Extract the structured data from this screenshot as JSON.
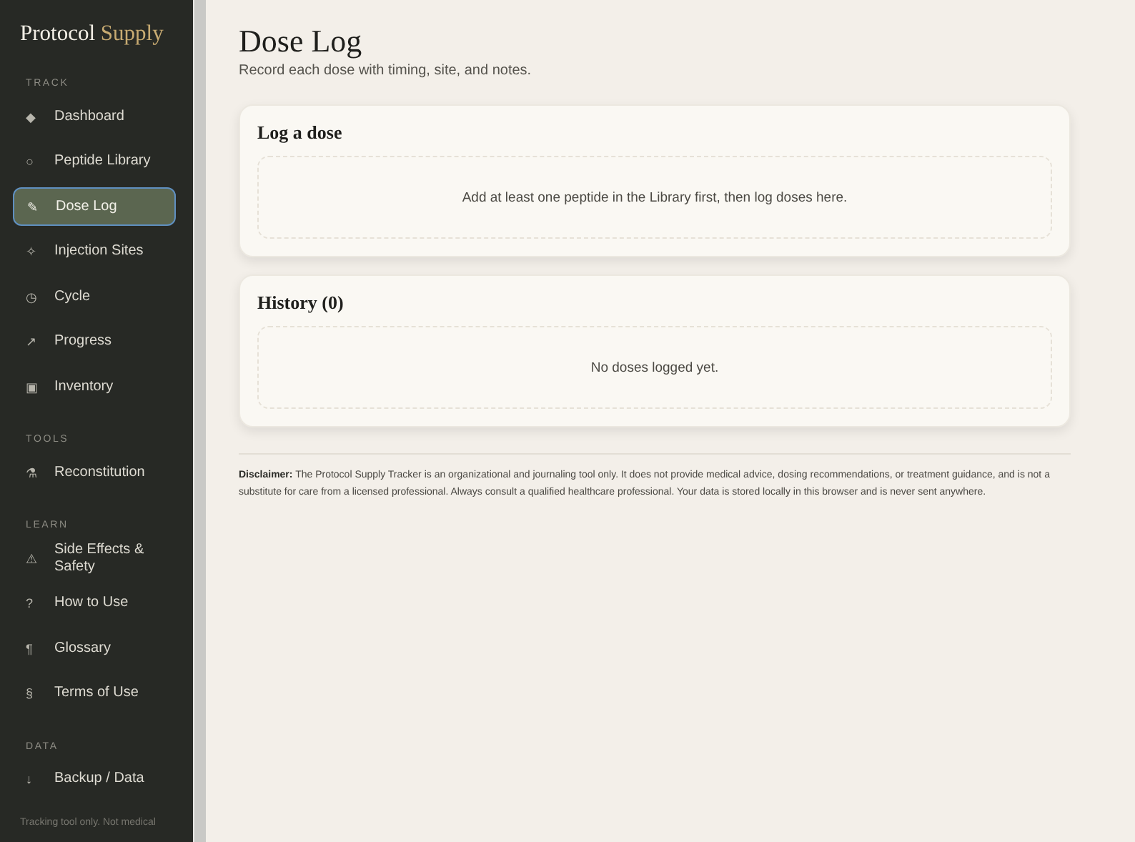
{
  "sidebar": {
    "brand": {
      "first": "Protocol",
      "second": "Supply"
    },
    "sections": [
      {
        "heading": "TRACK",
        "items": [
          {
            "icon": "◆",
            "label": "Dashboard",
            "selected": false
          },
          {
            "icon": "○",
            "label": "Peptide Library",
            "selected": false
          },
          {
            "icon": "✎",
            "label": "Dose Log",
            "selected": true
          },
          {
            "icon": "✧",
            "label": "Injection Sites",
            "selected": false
          },
          {
            "icon": "◷",
            "label": "Cycle",
            "selected": false
          },
          {
            "icon": "↗",
            "label": "Progress",
            "selected": false
          },
          {
            "icon": "▣",
            "label": "Inventory",
            "selected": false
          }
        ]
      },
      {
        "heading": "TOOLS",
        "items": [
          {
            "icon": "⚗",
            "label": "Reconstitution",
            "selected": false
          }
        ]
      },
      {
        "heading": "LEARN",
        "items": [
          {
            "icon": "⚠",
            "label": "Side Effects & Safety",
            "selected": false
          },
          {
            "icon": "?",
            "label": "How to Use",
            "selected": false
          },
          {
            "icon": "¶",
            "label": "Glossary",
            "selected": false
          },
          {
            "icon": "§",
            "label": "Terms of Use",
            "selected": false
          }
        ]
      },
      {
        "heading": "DATA",
        "items": [
          {
            "icon": "↓",
            "label": "Backup / Data",
            "selected": false
          }
        ]
      }
    ],
    "footer": "Tracking tool only. Not medical"
  },
  "page": {
    "title": "Dose Log",
    "subtitle": "Record each dose with timing, site, and notes."
  },
  "cards": [
    {
      "title": "Log a dose",
      "empty": "Add at least one peptide in the Library first, then log doses here."
    },
    {
      "title": "History (0)",
      "empty": "No doses logged yet."
    }
  ],
  "disclaimer": "**Disclaimer:** The Protocol Supply Tracker is an organizational and journaling tool only. It does not provide medical advice, dosing recommendations, or treatment guidance, and is not a substitute for care from a licensed professional. Always consult a qualified healthcare professional. Your data is stored locally in this browser and is never sent anywhere."
}
